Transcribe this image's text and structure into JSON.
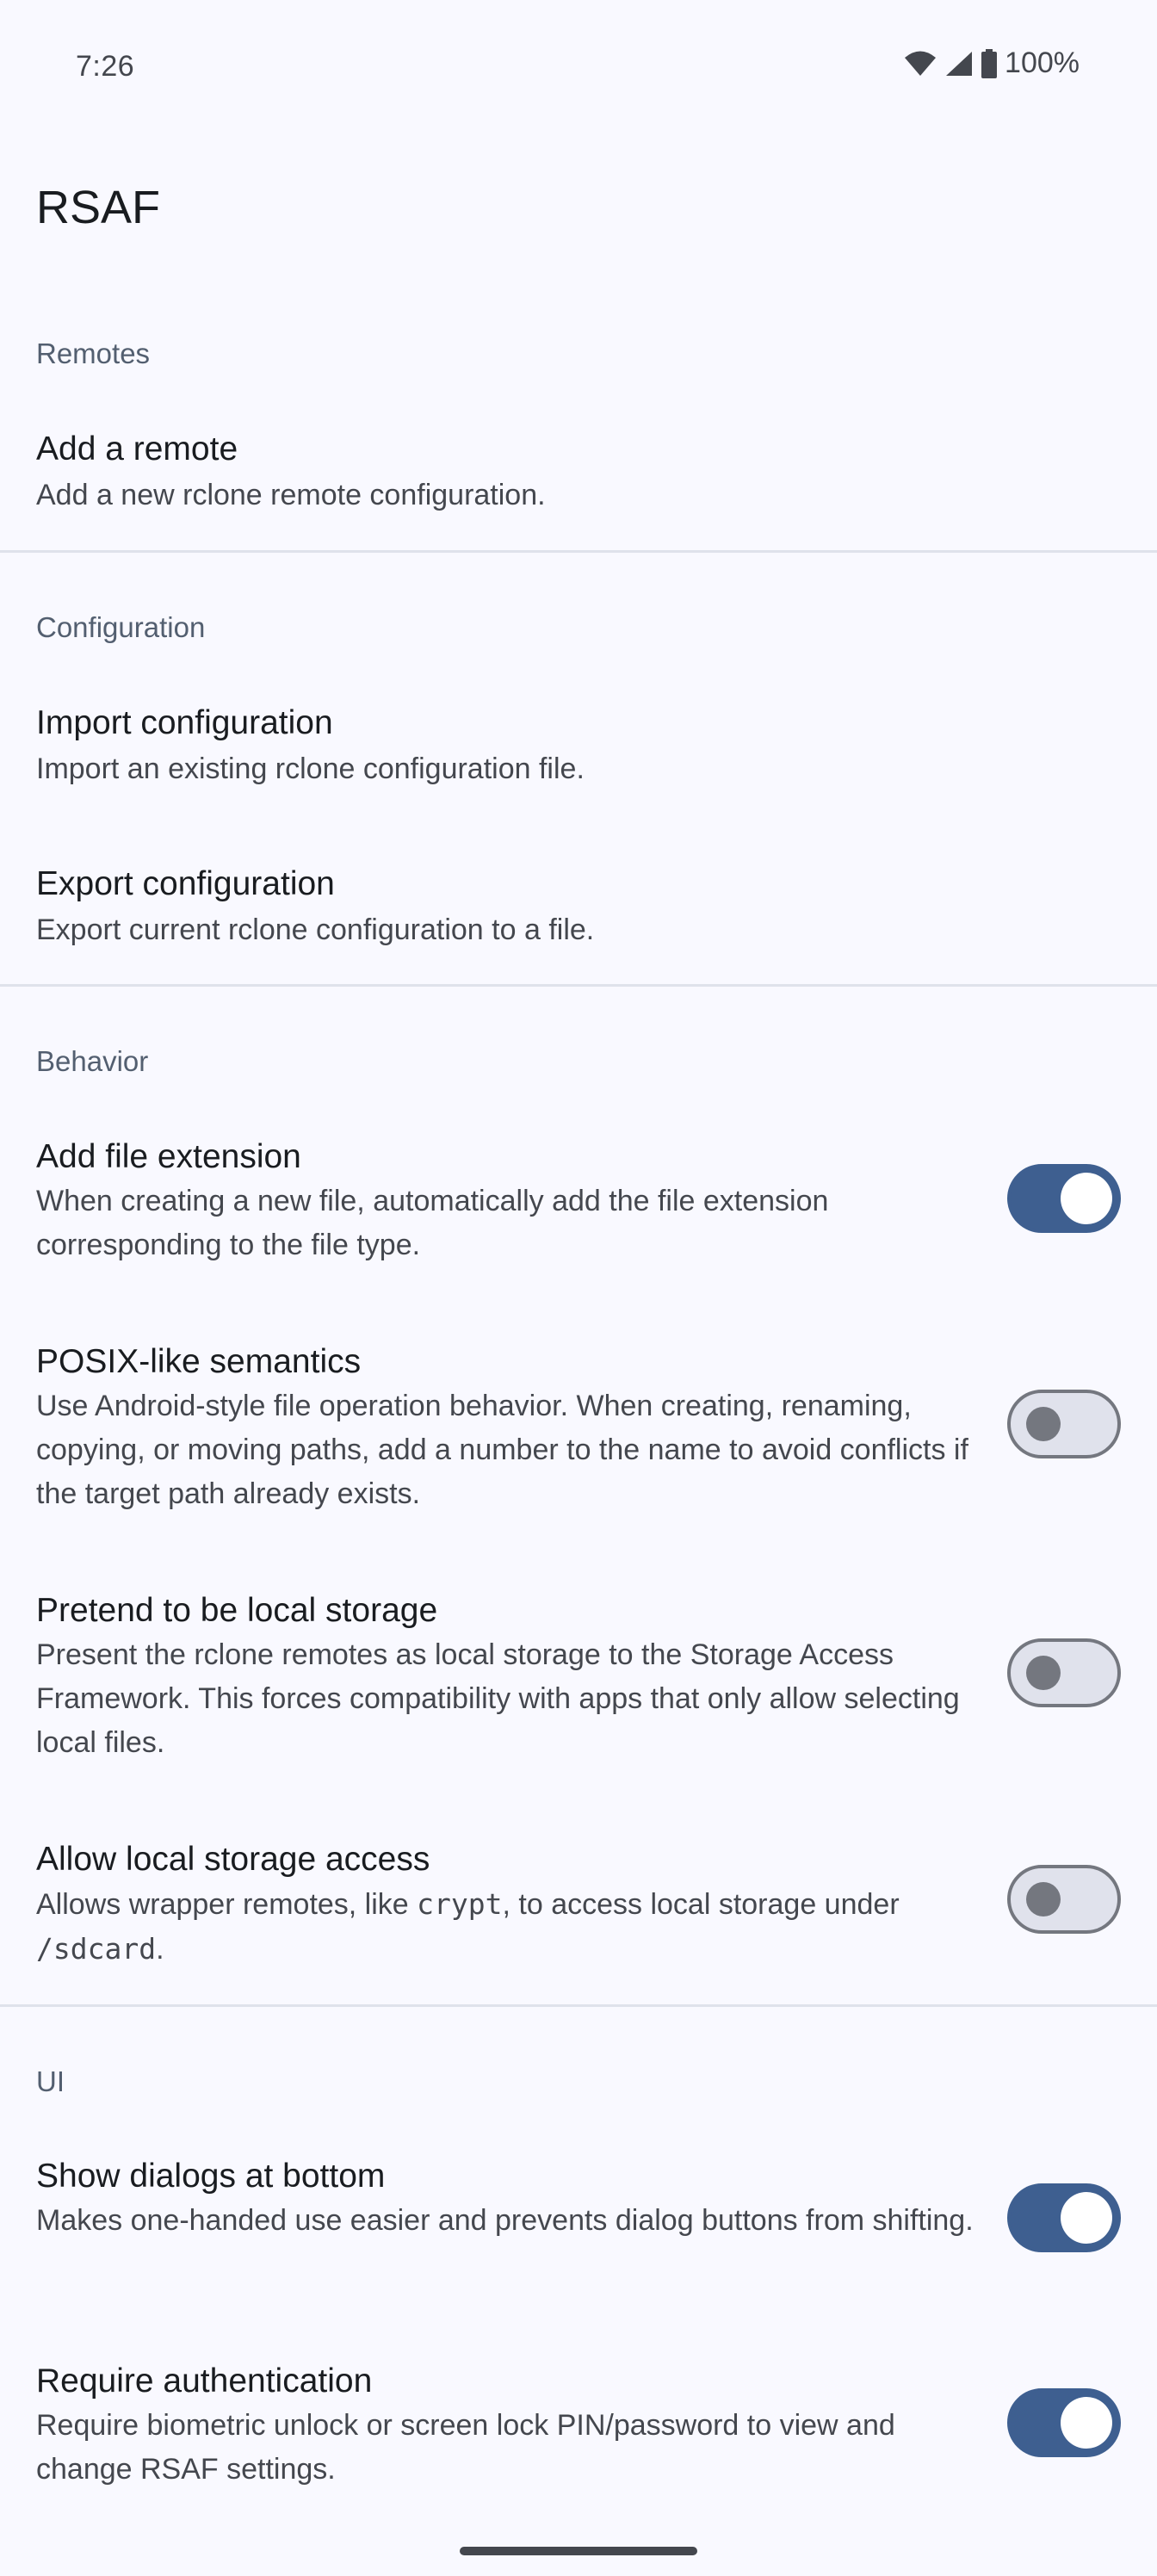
{
  "status_bar": {
    "time": "7:26",
    "battery": "100%"
  },
  "app": {
    "title": "RSAF"
  },
  "sections": {
    "remotes": {
      "header": "Remotes",
      "add_remote": {
        "title": "Add a remote",
        "summary": "Add a new rclone remote configuration."
      }
    },
    "configuration": {
      "header": "Configuration",
      "import": {
        "title": "Import configuration",
        "summary": "Import an existing rclone configuration file."
      },
      "export": {
        "title": "Export configuration",
        "summary": "Export current rclone configuration to a file."
      }
    },
    "behavior": {
      "header": "Behavior",
      "add_extension": {
        "title": "Add file extension",
        "summary": "When creating a new file, automatically add the file extension corresponding to the file type.",
        "enabled": true
      },
      "posix": {
        "title": "POSIX-like semantics",
        "summary": "Use Android-style file operation behavior. When creating, renaming, copying, or moving paths, add a number to the name to avoid conflicts if the target path already exists.",
        "enabled": false
      },
      "pretend_local": {
        "title": "Pretend to be local storage",
        "summary": "Present the rclone remotes as local storage to the Storage Access Framework. This forces compatibility with apps that only allow selecting local files.",
        "enabled": false
      },
      "local_access": {
        "title": "Allow local storage access",
        "summary_pre": "Allows wrapper remotes, like ",
        "summary_code1": "crypt",
        "summary_mid": ", to access local storage under ",
        "summary_code2": "/sdcard",
        "summary_post": ".",
        "enabled": false
      }
    },
    "ui": {
      "header": "UI",
      "dialogs_bottom": {
        "title": "Show dialogs at bottom",
        "summary": "Makes one-handed use easier and prevents dialog buttons from shifting.",
        "enabled": true
      },
      "require_auth": {
        "title": "Require authentication",
        "summary": "Require biometric unlock or screen lock PIN/password to view and change RSAF settings.",
        "enabled": true
      }
    }
  },
  "icons": {
    "wifi": "wifi-icon",
    "signal": "cell-signal-icon",
    "battery": "battery-icon"
  },
  "colors": {
    "accent": "#3e5f90",
    "background": "#f9f9ff",
    "section_header": "#535f70"
  }
}
